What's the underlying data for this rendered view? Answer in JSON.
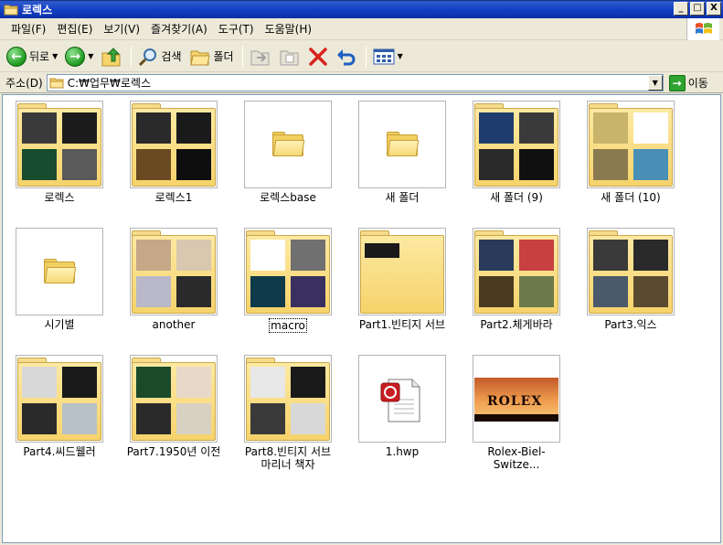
{
  "window": {
    "title": "로렉스",
    "buttons": {
      "minimize": "_",
      "maximize": "□",
      "close": "X"
    }
  },
  "menu": [
    "파일(F)",
    "편집(E)",
    "보기(V)",
    "즐겨찾기(A)",
    "도구(T)",
    "도움말(H)"
  ],
  "toolbar": {
    "back_label": "뒤로",
    "search_label": "검색",
    "folders_label": "폴더"
  },
  "address": {
    "label": "주소(D)",
    "value": "C:₩업무₩로렉스",
    "go_label": "이동"
  },
  "items": [
    {
      "label": "로렉스",
      "type": "folder-thumb",
      "thumb_colors": [
        "#3a3a3a",
        "#1c1c1c",
        "#174d2e",
        "#5a5a5a"
      ]
    },
    {
      "label": "로렉스1",
      "type": "folder-thumb",
      "thumb_colors": [
        "#2a2a2a",
        "#1a1a1a",
        "#6a4a20",
        "#0e0e0e"
      ]
    },
    {
      "label": "로렉스base",
      "type": "folder-empty"
    },
    {
      "label": "새 폴더",
      "type": "folder-empty"
    },
    {
      "label": "새 폴더 (9)",
      "type": "folder-thumb",
      "thumb_colors": [
        "#1e3d6e",
        "#3a3a3a",
        "#2a2a2a",
        "#101010"
      ]
    },
    {
      "label": "새 폴더 (10)",
      "type": "folder-thumb",
      "thumb_colors": [
        "#c8b46a",
        "#ffffff",
        "#8a7a50",
        "#4a8fb5"
      ]
    },
    {
      "label": "시기별",
      "type": "folder-empty"
    },
    {
      "label": "another",
      "type": "folder-thumb",
      "thumb_colors": [
        "#c4a888",
        "#d8c8b0",
        "#b8b8c8",
        "#2a2a2a"
      ]
    },
    {
      "label": "macro",
      "type": "folder-thumb",
      "selected": true,
      "thumb_colors": [
        "#ffffff",
        "#707070",
        "#0e3a4a",
        "#3a3060"
      ]
    },
    {
      "label": "Part1.빈티지 서브",
      "type": "folder-thumb",
      "thumb_colors": [
        "#1a1a1a"
      ]
    },
    {
      "label": "Part2.체게바라",
      "type": "folder-thumb",
      "thumb_colors": [
        "#2a3a5a",
        "#c84040",
        "#4a3a20",
        "#6a7a4a"
      ]
    },
    {
      "label": "Part3.익스",
      "type": "folder-thumb",
      "thumb_colors": [
        "#3a3a3a",
        "#2a2a2a",
        "#4a5a6a",
        "#5a4a30"
      ]
    },
    {
      "label": "Part4.씨드웰러",
      "type": "folder-thumb",
      "thumb_colors": [
        "#d8d8d8",
        "#1a1a1a",
        "#2a2a2a",
        "#b8c0c8"
      ]
    },
    {
      "label": "Part7.1950년 이전",
      "type": "folder-thumb",
      "thumb_colors": [
        "#1a4a2a",
        "#e8d8c8",
        "#2a2a2a",
        "#d8d0c0"
      ]
    },
    {
      "label": "Part8.빈티지 서브마리너 책자",
      "type": "folder-thumb",
      "thumb_colors": [
        "#e8e8e8",
        "#1a1a1a",
        "#3a3a3a",
        "#d8d8d8"
      ]
    },
    {
      "label": "1.hwp",
      "type": "hwp"
    },
    {
      "label": "Rolex-Biel-Switze...",
      "type": "image",
      "image_text": "ROLEX"
    }
  ]
}
